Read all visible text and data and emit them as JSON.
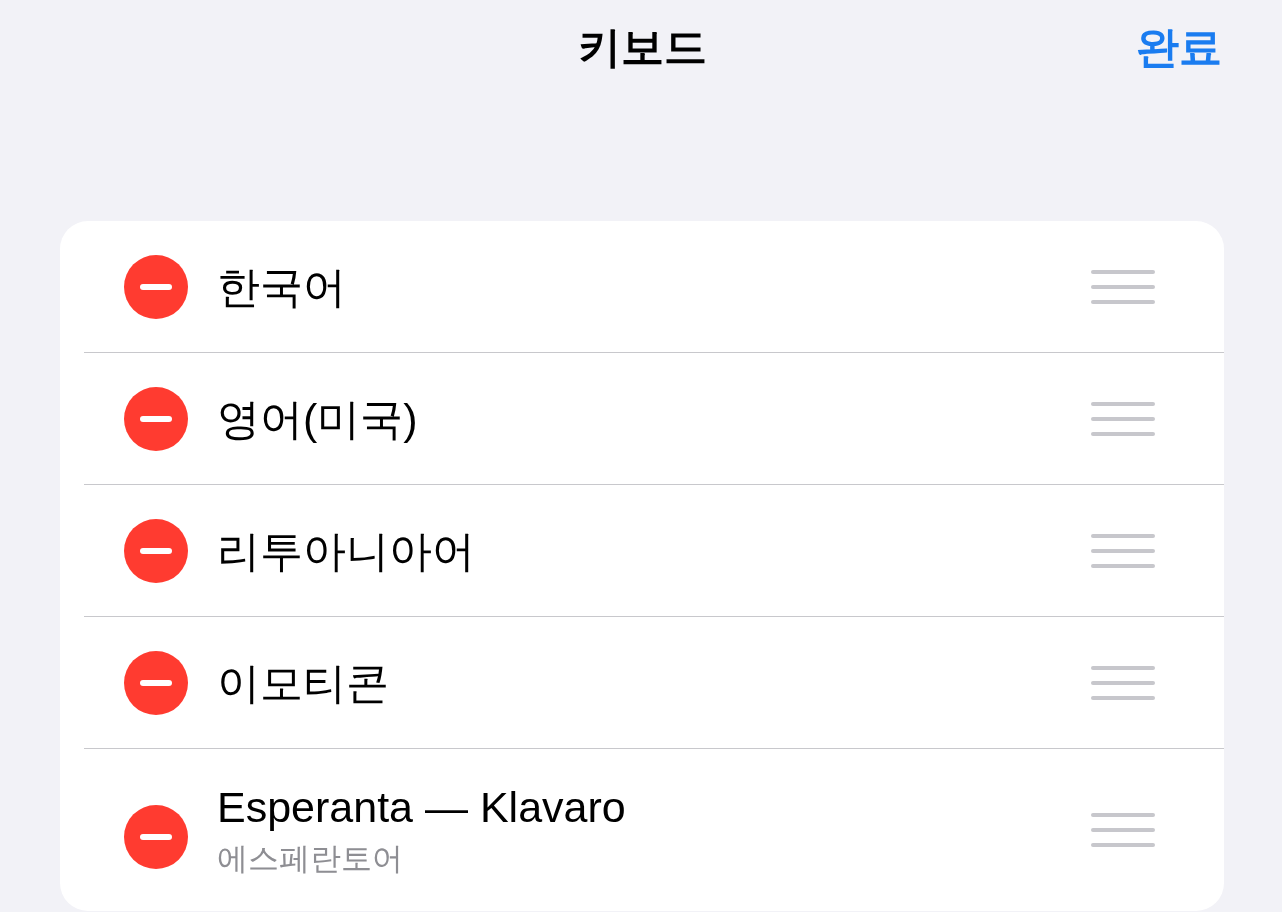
{
  "nav": {
    "title": "키보드",
    "done": "완료"
  },
  "keyboards": [
    {
      "name": "한국어"
    },
    {
      "name": "영어(미국)"
    },
    {
      "name": "리투아니아어"
    },
    {
      "name": "이모티콘"
    },
    {
      "name": "Esperanta — Klavaro",
      "subtitle": "에스페란토어"
    }
  ]
}
